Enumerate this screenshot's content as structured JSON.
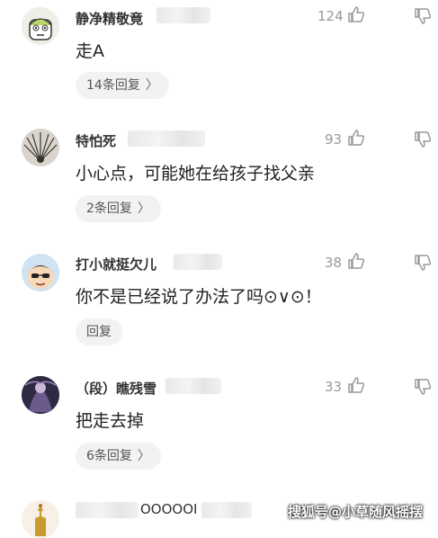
{
  "comments": [
    {
      "name": "静净精敬竟",
      "likes": "124",
      "text": "走A",
      "replies": "14条回复",
      "avatar_icon": "cartoon-face-avatar"
    },
    {
      "name": "特怕死",
      "likes": "93",
      "text": "小心点，可能她在给孩子找父亲",
      "replies": "2条回复",
      "avatar_icon": "feather-avatar"
    },
    {
      "name": "打小就挺欠儿",
      "likes": "38",
      "text": "你不是已经说了办法了吗⊙∨⊙！",
      "replies": "回复",
      "avatar_icon": "cartoon-boy-avatar"
    },
    {
      "name": "（段）瞧残雪",
      "likes": "33",
      "text": "把走去掉",
      "replies": "6条回复",
      "avatar_icon": "dark-purple-avatar"
    },
    {
      "name": "OOOOOI",
      "avatar_icon": "golden-statue-avatar"
    }
  ],
  "icons": {
    "like": "thumbs-up-icon",
    "dislike": "thumbs-down-icon",
    "chevron": "chevron-right-icon"
  },
  "reply_chevron": "〉",
  "watermark": "搜狐号@小草随风摇摆",
  "colors": {
    "text": "#222222",
    "meta": "#999999",
    "pill": "#f2f2f2"
  }
}
